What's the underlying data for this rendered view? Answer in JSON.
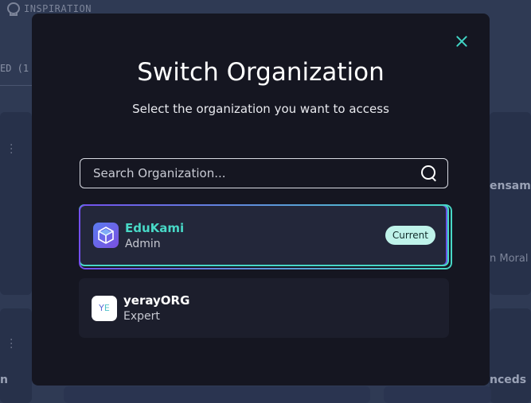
{
  "background": {
    "topbar_label": "INSPIRATION",
    "left_filter_text": "ED (1",
    "right_text_1": "ensam",
    "right_text_2": "n Moral",
    "right_text_3": "nceds",
    "bottom_left_text": "n"
  },
  "modal": {
    "title": "Switch Organization",
    "subtitle": "Select the organization you want to access",
    "close_icon": "close-icon",
    "search": {
      "placeholder": "Search Organization...",
      "value": "",
      "icon": "search-icon"
    },
    "organizations": [
      {
        "name": "EduKami",
        "role": "Admin",
        "logo": "cube-logo",
        "badge": "Current",
        "is_current": true
      },
      {
        "name": "yerayORG",
        "role": "Expert",
        "logo_text_1": "Y",
        "logo_text_2": "E",
        "is_current": false
      }
    ]
  },
  "colors": {
    "accent_teal": "#48d9c7",
    "accent_purple": "#7350ee",
    "modal_bg": "#151621",
    "badge_bg": "#bff3ea"
  }
}
